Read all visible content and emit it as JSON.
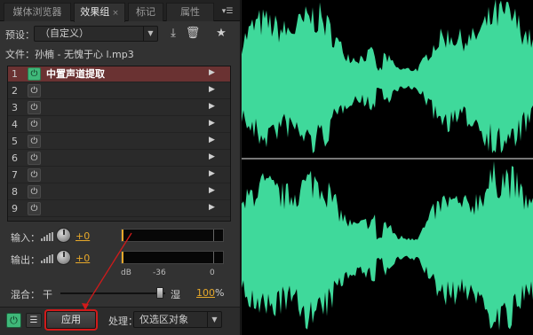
{
  "tabs": [
    {
      "label": "媒体浏览器",
      "active": false
    },
    {
      "label": "效果组",
      "active": true,
      "close": "×"
    },
    {
      "label": "标记",
      "active": false
    },
    {
      "label": "属性",
      "active": false
    }
  ],
  "tab_menu_icon": "▾☰",
  "preset": {
    "label": "预设：",
    "value": "（自定义）",
    "arrow": "▼"
  },
  "toolbar_icons": {
    "save": "⤓",
    "delete": "🗑",
    "favorite": "★"
  },
  "file": {
    "text": "文件：孙楠 - 无愧于心 l.mp3"
  },
  "rack": {
    "slots": [
      {
        "num": "1",
        "name": "中置声道提取",
        "active": true
      },
      {
        "num": "2",
        "name": "",
        "active": false
      },
      {
        "num": "3",
        "name": "",
        "active": false
      },
      {
        "num": "4",
        "name": "",
        "active": false
      },
      {
        "num": "5",
        "name": "",
        "active": false
      },
      {
        "num": "6",
        "name": "",
        "active": false
      },
      {
        "num": "7",
        "name": "",
        "active": false
      },
      {
        "num": "8",
        "name": "",
        "active": false
      },
      {
        "num": "9",
        "name": "",
        "active": false
      }
    ],
    "power_glyph": "⏻",
    "arrow_glyph": "▶"
  },
  "input": {
    "label": "输入：",
    "value": "+0"
  },
  "output": {
    "label": "输出：",
    "value": "+0"
  },
  "meter_scale": {
    "unit": "dB",
    "mid": "-36",
    "max": "0"
  },
  "mix": {
    "label": "混合：",
    "dry": "干",
    "wet": "湿",
    "value": "100",
    "unit": "%",
    "level": 1.0
  },
  "bottom": {
    "power_glyph": "⏻",
    "list_glyph": "☰",
    "apply": "应用",
    "process_label": "处理：",
    "process_value": "仅选区对象",
    "process_arrow": "▼"
  },
  "colors": {
    "waveform": "#3fd99b",
    "accent_value": "#e6a82a",
    "active_slot": "#6a3232",
    "annotation": "#d11a1a"
  }
}
